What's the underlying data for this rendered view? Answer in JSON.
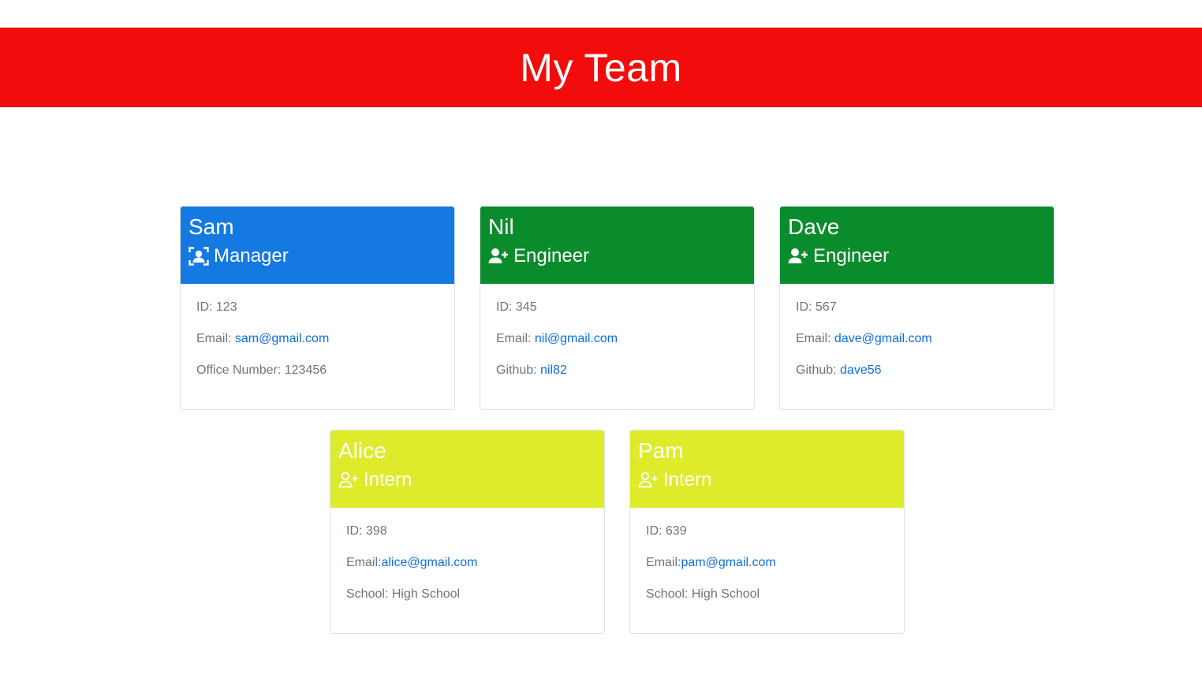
{
  "header": {
    "title": "My Team"
  },
  "colors": {
    "banner": "#f20c0c",
    "manager": "#1479e0",
    "engineer": "#0a8c2c",
    "intern": "#deeb2b",
    "link": "#0d6ee6"
  },
  "cards": [
    {
      "name": "Sam",
      "role": "Manager",
      "icon": "user-focus-icon",
      "id_label": "ID: 123",
      "email_label": "Email: ",
      "email": "sam@gmail.com",
      "extra_label": "Office Number: 123456",
      "extra_link": ""
    },
    {
      "name": "Nil",
      "role": "Engineer",
      "icon": "user-plus-icon",
      "id_label": "ID: 345",
      "email_label": "Email: ",
      "email": "nil@gmail.com",
      "extra_label": "Github: ",
      "extra_link": "nil82"
    },
    {
      "name": "Dave",
      "role": "Engineer",
      "icon": "user-plus-icon",
      "id_label": "ID: 567",
      "email_label": "Email: ",
      "email": "dave@gmail.com",
      "extra_label": "Github: ",
      "extra_link": "dave56"
    },
    {
      "name": "Alice",
      "role": "Intern",
      "icon": "user-plus-outline-icon",
      "id_label": "ID: 398",
      "email_label": "Email:",
      "email": "alice@gmail.com",
      "extra_label": "School: High School",
      "extra_link": ""
    },
    {
      "name": "Pam",
      "role": "Intern",
      "icon": "user-plus-outline-icon",
      "id_label": "ID: 639",
      "email_label": "Email:",
      "email": "pam@gmail.com",
      "extra_label": "School: High School",
      "extra_link": ""
    }
  ]
}
